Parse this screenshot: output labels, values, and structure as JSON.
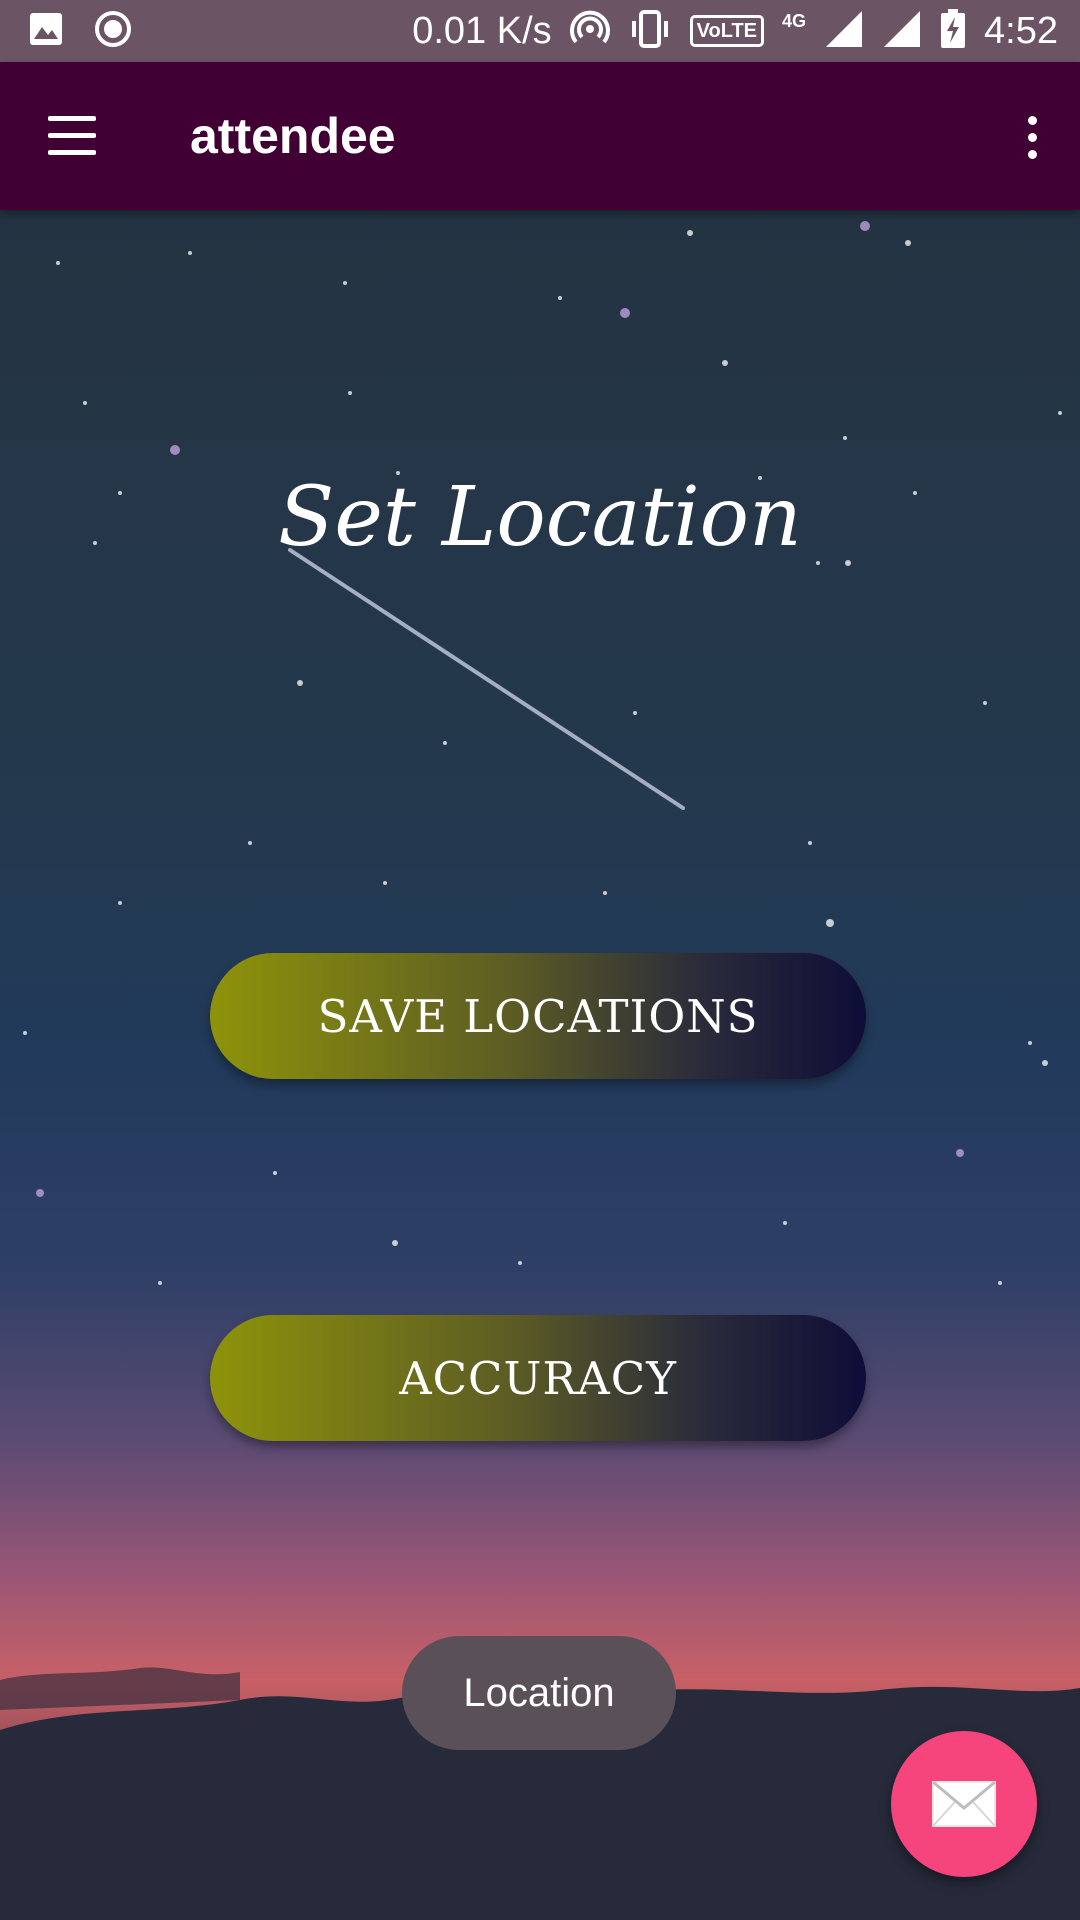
{
  "status_bar": {
    "network_speed": "0.01 K/s",
    "volte": "VoLTE",
    "network_type": "4G",
    "time": "4:52",
    "icons": [
      "gallery-icon",
      "record-icon",
      "hotspot-icon",
      "vibrate-icon",
      "signal-icon",
      "signal-icon",
      "battery-charging-icon"
    ]
  },
  "app_bar": {
    "title": "attendee",
    "menu_icon": "hamburger-menu-icon",
    "overflow_icon": "more-vert-icon"
  },
  "main": {
    "heading": "Set Location",
    "buttons": {
      "save": "SAVE LOCATIONS",
      "accuracy": "ACCURACY"
    }
  },
  "toast": {
    "text": "Location"
  },
  "fab": {
    "icon": "email-icon"
  },
  "colors": {
    "status_bar": "#6b5565",
    "app_bar": "#410034",
    "fab": "#f6457d",
    "button_gradient_start": "#8e930a",
    "button_gradient_end": "#0e0d38"
  }
}
